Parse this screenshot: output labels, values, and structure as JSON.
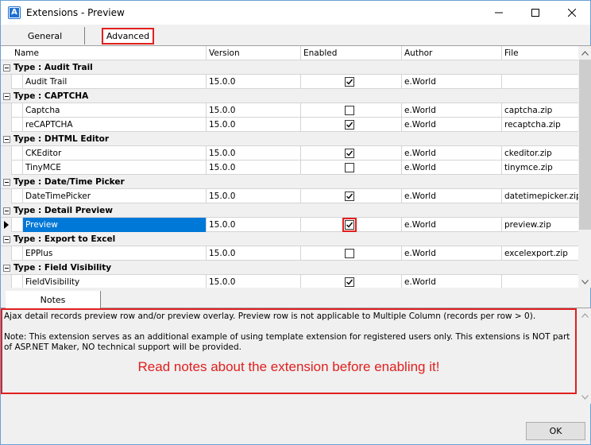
{
  "window": {
    "title": "Extensions - Preview",
    "icon": "app-logo-icon",
    "icon_letter": "A"
  },
  "tabs": [
    {
      "label": "General"
    },
    {
      "label": "Advanced"
    }
  ],
  "grid": {
    "columns": [
      "Name",
      "Version",
      "Enabled",
      "Author",
      "File"
    ],
    "rows": [
      {
        "kind": "group",
        "label": "Type : Audit Trail"
      },
      {
        "kind": "item",
        "name": "Audit Trail",
        "version": "15.0.0",
        "enabled": true,
        "author": "e.World",
        "file": ""
      },
      {
        "kind": "group",
        "label": "Type : CAPTCHA"
      },
      {
        "kind": "item",
        "name": "Captcha",
        "version": "15.0.0",
        "enabled": false,
        "author": "e.World",
        "file": "captcha.zip"
      },
      {
        "kind": "item",
        "name": "reCAPTCHA",
        "version": "15.0.0",
        "enabled": true,
        "author": "e.World",
        "file": "recaptcha.zip"
      },
      {
        "kind": "group",
        "label": "Type : DHTML Editor"
      },
      {
        "kind": "item",
        "name": "CKEditor",
        "version": "15.0.0",
        "enabled": true,
        "author": "e.World",
        "file": "ckeditor.zip"
      },
      {
        "kind": "item",
        "name": "TinyMCE",
        "version": "15.0.0",
        "enabled": false,
        "author": "e.World",
        "file": "tinymce.zip"
      },
      {
        "kind": "group",
        "label": "Type : Date/Time Picker"
      },
      {
        "kind": "item",
        "name": "DateTimePicker",
        "version": "15.0.0",
        "enabled": true,
        "author": "e.World",
        "file": "datetimepicker.zip"
      },
      {
        "kind": "group",
        "label": "Type : Detail Preview"
      },
      {
        "kind": "item",
        "name": "Preview",
        "version": "15.0.0",
        "enabled": true,
        "author": "e.World",
        "file": "preview.zip",
        "selected": true
      },
      {
        "kind": "group",
        "label": "Type : Export to Excel"
      },
      {
        "kind": "item",
        "name": "EPPlus",
        "version": "15.0.0",
        "enabled": false,
        "author": "e.World",
        "file": "excelexport.zip"
      },
      {
        "kind": "group",
        "label": "Type : Field Visibility"
      },
      {
        "kind": "item",
        "name": "FieldVisibility",
        "version": "15.0.0",
        "enabled": true,
        "author": "e.World",
        "file": ""
      }
    ]
  },
  "notes": {
    "tab_label": "Notes",
    "paragraph_1": "Ajax detail records preview row and/or preview overlay. Preview row is not applicable to Multiple Column (records per row > 0).",
    "paragraph_2": "Note: This extension serves as an additional example of using template extension for registered users only. This extensions is NOT part of ASP.NET Maker, NO technical support will be provided.",
    "annotation": "Read notes about the extension before enabling it!"
  },
  "footer": {
    "ok_label": "OK"
  },
  "colors": {
    "accent_red": "#e0201f",
    "selection_blue": "#0078d7"
  }
}
